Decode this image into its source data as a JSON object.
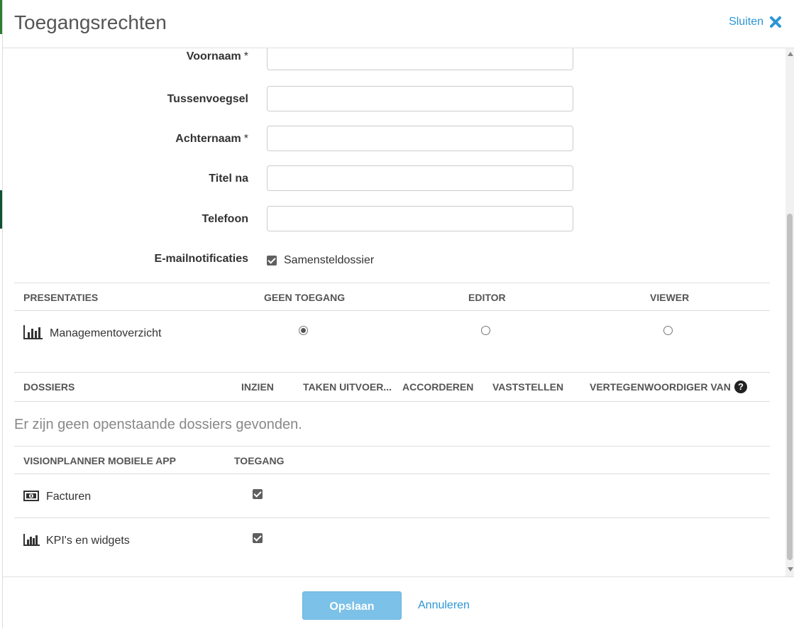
{
  "header": {
    "title": "Toegangsrechten",
    "close_label": "Sluiten",
    "close_icon": "close-x-icon"
  },
  "form": {
    "required_marker": "*",
    "fields": [
      {
        "label": "Voornaam",
        "required": true,
        "value": "",
        "placeholder": ""
      },
      {
        "label": "Tussenvoegsel",
        "required": false,
        "value": "",
        "placeholder": ""
      },
      {
        "label": "Achternaam",
        "required": true,
        "value": "",
        "placeholder": ""
      },
      {
        "label": "Titel na",
        "required": false,
        "value": "",
        "placeholder": ""
      },
      {
        "label": "Telefoon",
        "required": false,
        "value": "",
        "placeholder": ""
      }
    ],
    "email": {
      "label": "E-mailnotificaties",
      "option_label": "Samensteldossier",
      "checked": true
    }
  },
  "presentaties": {
    "headers": [
      "PRESENTATIES",
      "GEEN TOEGANG",
      "EDITOR",
      "VIEWER"
    ],
    "rows": [
      {
        "icon": "bar-chart-icon",
        "label": "Managementoverzicht",
        "selected": "GEEN TOEGANG"
      }
    ]
  },
  "dossiers": {
    "headers": [
      "DOSSIERS",
      "INZIEN",
      "TAKEN UITVOER...",
      "ACCORDEREN",
      "VASTSTELLEN",
      "VERTEGENWOORDIGER VAN"
    ],
    "help_icon": "question-circle-icon",
    "help_glyph": "?",
    "empty_message": "Er zijn geen openstaande dossiers gevonden."
  },
  "mobile_app": {
    "headers": [
      "VISIONPLANNER MOBIELE APP",
      "TOEGANG"
    ],
    "rows": [
      {
        "icon": "money-bill-icon",
        "label": "Facturen",
        "access": true
      },
      {
        "icon": "bar-chart-icon",
        "label": "KPI's en widgets",
        "access": true
      }
    ]
  },
  "footer": {
    "save_label": "Opslaan",
    "cancel_label": "Annuleren"
  },
  "colors": {
    "link": "#2b95d6",
    "primary_button": "#7cc1e8",
    "checkbox": "#5f5f5f"
  }
}
